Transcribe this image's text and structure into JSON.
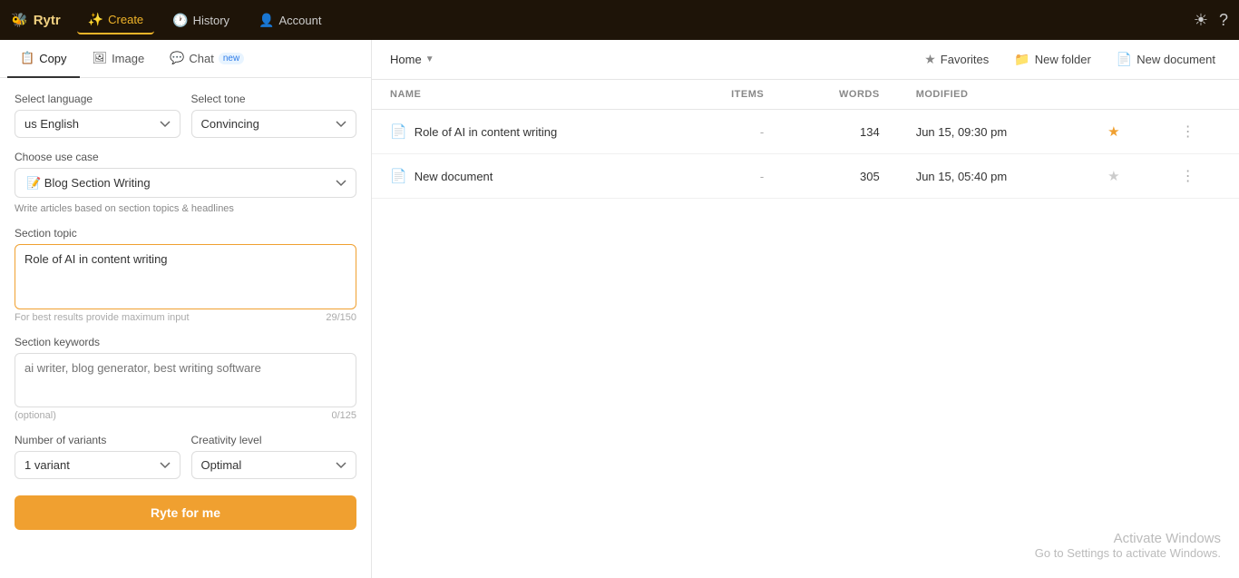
{
  "topnav": {
    "logo_icon": "🐝",
    "logo_label": "Rytr",
    "items": [
      {
        "id": "create",
        "label": "Create",
        "icon": "✨",
        "active": true
      },
      {
        "id": "history",
        "label": "History",
        "icon": "🕐",
        "active": false
      },
      {
        "id": "account",
        "label": "Account",
        "icon": "👤",
        "active": false
      }
    ],
    "right_icons": [
      "☀",
      "?"
    ]
  },
  "tabs": [
    {
      "id": "copy",
      "label": "Copy",
      "icon": "📋",
      "badge": null
    },
    {
      "id": "image",
      "label": "Image",
      "icon": "🖼",
      "badge": null
    },
    {
      "id": "chat",
      "label": "Chat",
      "icon": "💬",
      "badge": "new"
    }
  ],
  "form": {
    "language_label": "Select language",
    "language_value": "us English",
    "tone_label": "Select tone",
    "tone_value": "Convincing",
    "use_case_label": "Choose use case",
    "use_case_value": "Blog Section Writing",
    "use_case_desc": "Write articles based on section topics & headlines",
    "section_topic_label": "Section topic",
    "section_topic_value": "Role of AI in content writing",
    "section_topic_placeholder": "Role of AI in content writing",
    "section_topic_hint": "For best results provide maximum input",
    "section_topic_count": "29/150",
    "keywords_label": "Section keywords",
    "keywords_placeholder": "ai writer, blog generator, best writing software",
    "keywords_optional": "(optional)",
    "keywords_count": "0/125",
    "variants_label": "Number of variants",
    "variants_value": "1 variant",
    "creativity_label": "Creativity level",
    "creativity_value": "Optimal",
    "generate_btn": "Ryte for me"
  },
  "documents": {
    "home_label": "Home",
    "actions": [
      {
        "id": "favorites",
        "label": "Favorites",
        "icon": "★"
      },
      {
        "id": "new-folder",
        "label": "New folder",
        "icon": "📁"
      },
      {
        "id": "new-document",
        "label": "New document",
        "icon": "📄"
      }
    ],
    "columns": [
      {
        "id": "name",
        "label": "NAME"
      },
      {
        "id": "items",
        "label": "ITEMS"
      },
      {
        "id": "words",
        "label": "WORDS"
      },
      {
        "id": "modified",
        "label": "MODIFIED"
      }
    ],
    "rows": [
      {
        "id": 1,
        "name": "Role of AI in content writing",
        "items": "-",
        "words": "134",
        "modified": "Jun 15, 09:30 pm",
        "starred": true
      },
      {
        "id": 2,
        "name": "New document",
        "items": "-",
        "words": "305",
        "modified": "Jun 15, 05:40 pm",
        "starred": false
      }
    ]
  },
  "watermark": {
    "title": "Activate Windows",
    "subtitle": "Go to Settings to activate Windows."
  }
}
